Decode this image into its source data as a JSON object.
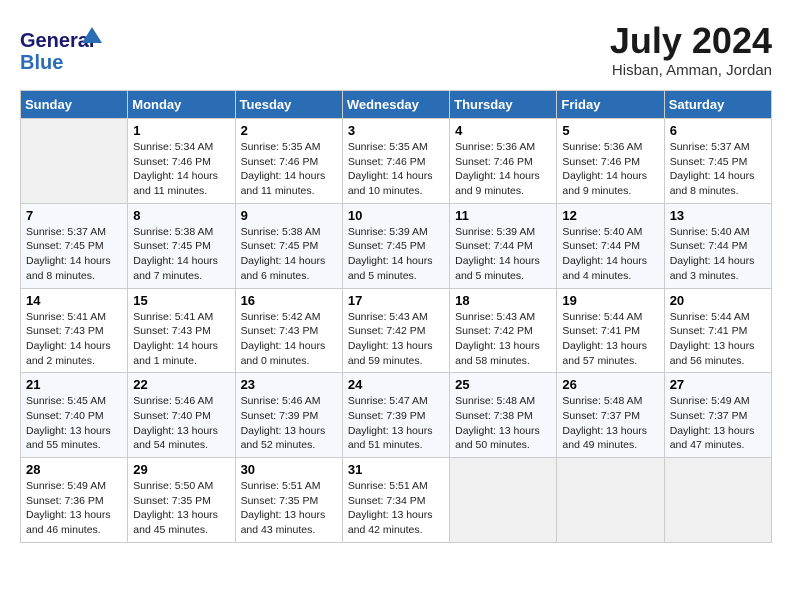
{
  "logo": {
    "line1": "General",
    "line2": "Blue"
  },
  "title": "July 2024",
  "location": "Hisban, Amman, Jordan",
  "weekdays": [
    "Sunday",
    "Monday",
    "Tuesday",
    "Wednesday",
    "Thursday",
    "Friday",
    "Saturday"
  ],
  "weeks": [
    [
      {
        "day": "",
        "sunrise": "",
        "sunset": "",
        "daylight": ""
      },
      {
        "day": "1",
        "sunrise": "Sunrise: 5:34 AM",
        "sunset": "Sunset: 7:46 PM",
        "daylight": "Daylight: 14 hours and 11 minutes."
      },
      {
        "day": "2",
        "sunrise": "Sunrise: 5:35 AM",
        "sunset": "Sunset: 7:46 PM",
        "daylight": "Daylight: 14 hours and 11 minutes."
      },
      {
        "day": "3",
        "sunrise": "Sunrise: 5:35 AM",
        "sunset": "Sunset: 7:46 PM",
        "daylight": "Daylight: 14 hours and 10 minutes."
      },
      {
        "day": "4",
        "sunrise": "Sunrise: 5:36 AM",
        "sunset": "Sunset: 7:46 PM",
        "daylight": "Daylight: 14 hours and 9 minutes."
      },
      {
        "day": "5",
        "sunrise": "Sunrise: 5:36 AM",
        "sunset": "Sunset: 7:46 PM",
        "daylight": "Daylight: 14 hours and 9 minutes."
      },
      {
        "day": "6",
        "sunrise": "Sunrise: 5:37 AM",
        "sunset": "Sunset: 7:45 PM",
        "daylight": "Daylight: 14 hours and 8 minutes."
      }
    ],
    [
      {
        "day": "7",
        "sunrise": "Sunrise: 5:37 AM",
        "sunset": "Sunset: 7:45 PM",
        "daylight": "Daylight: 14 hours and 8 minutes."
      },
      {
        "day": "8",
        "sunrise": "Sunrise: 5:38 AM",
        "sunset": "Sunset: 7:45 PM",
        "daylight": "Daylight: 14 hours and 7 minutes."
      },
      {
        "day": "9",
        "sunrise": "Sunrise: 5:38 AM",
        "sunset": "Sunset: 7:45 PM",
        "daylight": "Daylight: 14 hours and 6 minutes."
      },
      {
        "day": "10",
        "sunrise": "Sunrise: 5:39 AM",
        "sunset": "Sunset: 7:45 PM",
        "daylight": "Daylight: 14 hours and 5 minutes."
      },
      {
        "day": "11",
        "sunrise": "Sunrise: 5:39 AM",
        "sunset": "Sunset: 7:44 PM",
        "daylight": "Daylight: 14 hours and 5 minutes."
      },
      {
        "day": "12",
        "sunrise": "Sunrise: 5:40 AM",
        "sunset": "Sunset: 7:44 PM",
        "daylight": "Daylight: 14 hours and 4 minutes."
      },
      {
        "day": "13",
        "sunrise": "Sunrise: 5:40 AM",
        "sunset": "Sunset: 7:44 PM",
        "daylight": "Daylight: 14 hours and 3 minutes."
      }
    ],
    [
      {
        "day": "14",
        "sunrise": "Sunrise: 5:41 AM",
        "sunset": "Sunset: 7:43 PM",
        "daylight": "Daylight: 14 hours and 2 minutes."
      },
      {
        "day": "15",
        "sunrise": "Sunrise: 5:41 AM",
        "sunset": "Sunset: 7:43 PM",
        "daylight": "Daylight: 14 hours and 1 minute."
      },
      {
        "day": "16",
        "sunrise": "Sunrise: 5:42 AM",
        "sunset": "Sunset: 7:43 PM",
        "daylight": "Daylight: 14 hours and 0 minutes."
      },
      {
        "day": "17",
        "sunrise": "Sunrise: 5:43 AM",
        "sunset": "Sunset: 7:42 PM",
        "daylight": "Daylight: 13 hours and 59 minutes."
      },
      {
        "day": "18",
        "sunrise": "Sunrise: 5:43 AM",
        "sunset": "Sunset: 7:42 PM",
        "daylight": "Daylight: 13 hours and 58 minutes."
      },
      {
        "day": "19",
        "sunrise": "Sunrise: 5:44 AM",
        "sunset": "Sunset: 7:41 PM",
        "daylight": "Daylight: 13 hours and 57 minutes."
      },
      {
        "day": "20",
        "sunrise": "Sunrise: 5:44 AM",
        "sunset": "Sunset: 7:41 PM",
        "daylight": "Daylight: 13 hours and 56 minutes."
      }
    ],
    [
      {
        "day": "21",
        "sunrise": "Sunrise: 5:45 AM",
        "sunset": "Sunset: 7:40 PM",
        "daylight": "Daylight: 13 hours and 55 minutes."
      },
      {
        "day": "22",
        "sunrise": "Sunrise: 5:46 AM",
        "sunset": "Sunset: 7:40 PM",
        "daylight": "Daylight: 13 hours and 54 minutes."
      },
      {
        "day": "23",
        "sunrise": "Sunrise: 5:46 AM",
        "sunset": "Sunset: 7:39 PM",
        "daylight": "Daylight: 13 hours and 52 minutes."
      },
      {
        "day": "24",
        "sunrise": "Sunrise: 5:47 AM",
        "sunset": "Sunset: 7:39 PM",
        "daylight": "Daylight: 13 hours and 51 minutes."
      },
      {
        "day": "25",
        "sunrise": "Sunrise: 5:48 AM",
        "sunset": "Sunset: 7:38 PM",
        "daylight": "Daylight: 13 hours and 50 minutes."
      },
      {
        "day": "26",
        "sunrise": "Sunrise: 5:48 AM",
        "sunset": "Sunset: 7:37 PM",
        "daylight": "Daylight: 13 hours and 49 minutes."
      },
      {
        "day": "27",
        "sunrise": "Sunrise: 5:49 AM",
        "sunset": "Sunset: 7:37 PM",
        "daylight": "Daylight: 13 hours and 47 minutes."
      }
    ],
    [
      {
        "day": "28",
        "sunrise": "Sunrise: 5:49 AM",
        "sunset": "Sunset: 7:36 PM",
        "daylight": "Daylight: 13 hours and 46 minutes."
      },
      {
        "day": "29",
        "sunrise": "Sunrise: 5:50 AM",
        "sunset": "Sunset: 7:35 PM",
        "daylight": "Daylight: 13 hours and 45 minutes."
      },
      {
        "day": "30",
        "sunrise": "Sunrise: 5:51 AM",
        "sunset": "Sunset: 7:35 PM",
        "daylight": "Daylight: 13 hours and 43 minutes."
      },
      {
        "day": "31",
        "sunrise": "Sunrise: 5:51 AM",
        "sunset": "Sunset: 7:34 PM",
        "daylight": "Daylight: 13 hours and 42 minutes."
      },
      {
        "day": "",
        "sunrise": "",
        "sunset": "",
        "daylight": ""
      },
      {
        "day": "",
        "sunrise": "",
        "sunset": "",
        "daylight": ""
      },
      {
        "day": "",
        "sunrise": "",
        "sunset": "",
        "daylight": ""
      }
    ]
  ]
}
